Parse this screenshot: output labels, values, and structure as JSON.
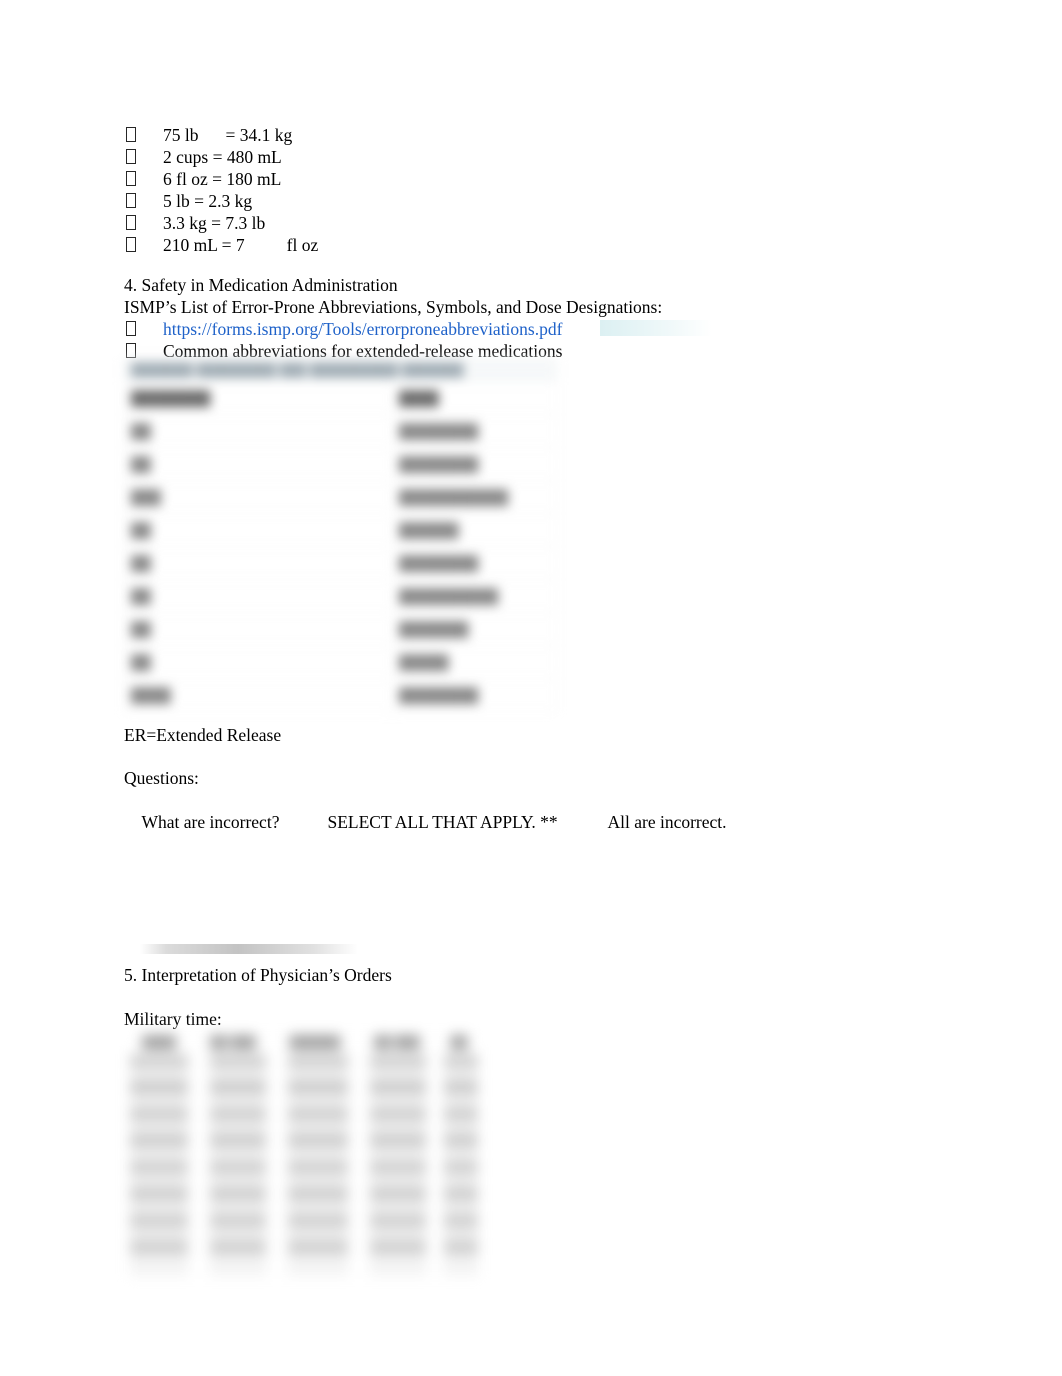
{
  "document": {
    "conversions": {
      "bullet_glyph": "tofu-box",
      "items": [
        {
          "left": "75 lb",
          "gap": true,
          "right": "= 34.1 kg"
        },
        {
          "left": "2 cups = 480 mL",
          "gap": false,
          "right": ""
        },
        {
          "left": "6 fl oz = 180 mL",
          "gap": false,
          "right": ""
        },
        {
          "left": "5 lb = 2.3 kg",
          "gap": false,
          "right": ""
        },
        {
          "left": "3.3 kg = 7.3 lb",
          "gap": false,
          "right": ""
        },
        {
          "left": "210 mL = 7",
          "gap": true,
          "right": "fl oz"
        }
      ]
    },
    "section4": {
      "heading": "4. Safety in Medication Administration",
      "subheading": "ISMP’s List of Error-Prone Abbreviations, Symbols, and Dose Designations:",
      "link_text": "https://forms.ismp.org/Tools/errorproneabbreviations.pdf",
      "link_color": "#1f62c9",
      "bullet2": "Common abbreviations for extended-release medications"
    },
    "abbrev_table": {
      "redacted": true,
      "note": "content obscured by blur in source image",
      "band_row": "███████  █████████  ███  ██████████  ███████",
      "columns": [
        "████████",
        "████"
      ],
      "rows": [
        [
          "██",
          "████████"
        ],
        [
          "██",
          "████████"
        ],
        [
          "███",
          "███████████"
        ],
        [
          "██",
          "██████"
        ],
        [
          "██",
          "████████"
        ],
        [
          "██",
          "██████████"
        ],
        [
          "██",
          "███████"
        ],
        [
          "██",
          "█████"
        ],
        [
          "████",
          "████████"
        ]
      ]
    },
    "legend": "ER=Extended Release",
    "questions": {
      "label": "Questions:",
      "q_part1": "What are incorrect?",
      "q_part2": "SELECT ALL THAT APPLY. **",
      "q_part3": "All are incorrect."
    },
    "section5": {
      "heading": "5. Interpretation of Physician’s Orders",
      "subheading": "Military time:"
    },
    "military_time_image": {
      "redacted": true,
      "note": "blurred military time conversion chart image",
      "column_headers": [
        "████",
        "██ ███",
        "██████",
        "██ ███",
        "██"
      ]
    }
  }
}
